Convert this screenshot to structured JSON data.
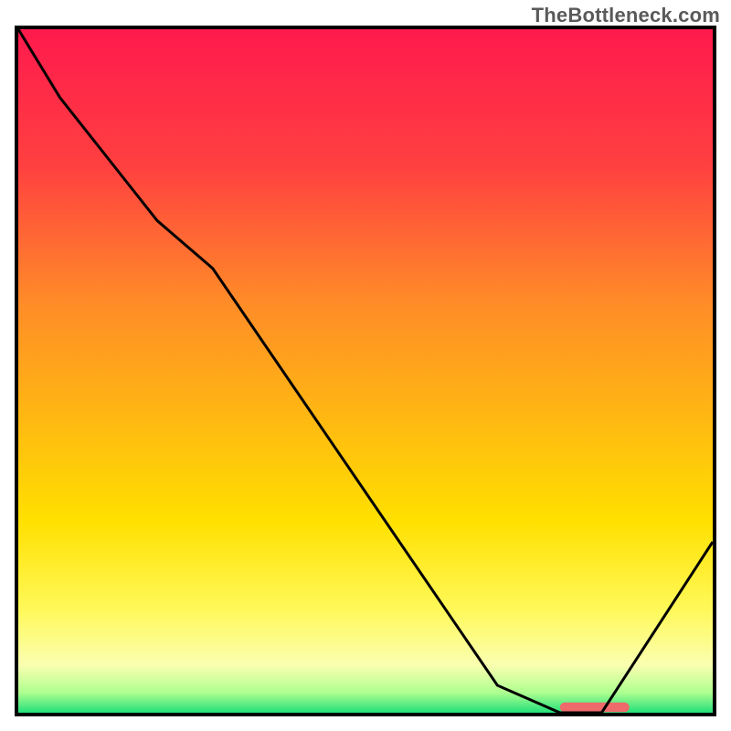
{
  "attribution": "TheBottleneck.com",
  "chart_data": {
    "type": "line",
    "title": "",
    "xlabel": "",
    "ylabel": "",
    "xlim": [
      0,
      100
    ],
    "ylim": [
      0,
      100
    ],
    "background_gradient_stops": [
      {
        "offset": 0.0,
        "color": "#ff1a4d"
      },
      {
        "offset": 0.2,
        "color": "#ff4040"
      },
      {
        "offset": 0.4,
        "color": "#ff8c28"
      },
      {
        "offset": 0.55,
        "color": "#ffb314"
      },
      {
        "offset": 0.72,
        "color": "#ffe000"
      },
      {
        "offset": 0.85,
        "color": "#fff95a"
      },
      {
        "offset": 0.93,
        "color": "#faffb0"
      },
      {
        "offset": 0.97,
        "color": "#b0ff90"
      },
      {
        "offset": 1.0,
        "color": "#22e07a"
      }
    ],
    "curve": {
      "x": [
        0,
        6,
        20,
        28,
        69,
        78,
        84,
        100
      ],
      "y": [
        100,
        90,
        72,
        65,
        4,
        0,
        0,
        25
      ]
    },
    "marker": {
      "x_start": 78,
      "x_end": 88,
      "y": 0.8,
      "color": "#ef6a6a"
    }
  }
}
